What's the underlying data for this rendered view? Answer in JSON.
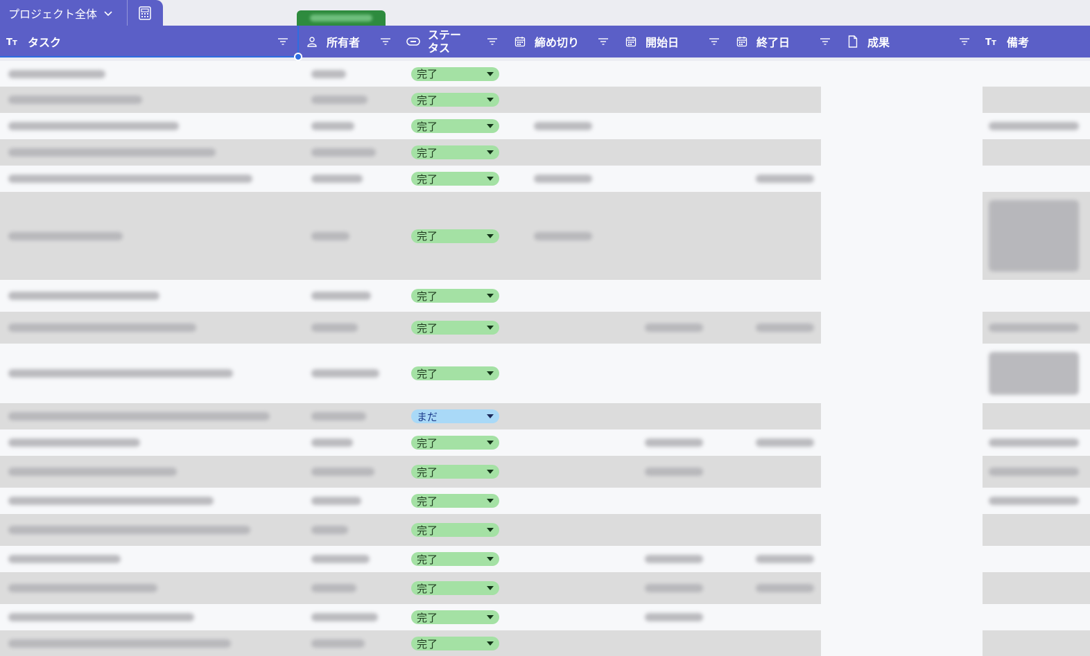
{
  "view": {
    "name": "プロジェクト全体",
    "icons": {
      "dropdown": "chevron-down-icon",
      "calculator": "calculator-icon"
    }
  },
  "columns": [
    {
      "key": "task",
      "label": "タスク",
      "icon": "text-type-icon"
    },
    {
      "key": "owner",
      "label": "所有者",
      "icon": "person-icon"
    },
    {
      "key": "status",
      "label": "ステータス",
      "icon": "status-icon"
    },
    {
      "key": "deadline",
      "label": "締め切り",
      "icon": "calendar-icon"
    },
    {
      "key": "start",
      "label": "開始日",
      "icon": "calendar-icon"
    },
    {
      "key": "end",
      "label": "終了日",
      "icon": "calendar-icon"
    },
    {
      "key": "result",
      "label": "成果",
      "icon": "file-icon"
    },
    {
      "key": "notes",
      "label": "備考",
      "icon": "text-type-icon"
    }
  ],
  "statuses": {
    "done": "完了",
    "todo": "まだ"
  },
  "rows": [
    {
      "status": "done"
    },
    {
      "status": "done"
    },
    {
      "status": "done"
    },
    {
      "status": "done"
    },
    {
      "status": "done"
    },
    {
      "status": "done"
    },
    {
      "status": "done"
    },
    {
      "status": "done"
    },
    {
      "status": "done"
    },
    {
      "status": "todo"
    },
    {
      "status": "done"
    },
    {
      "status": "done"
    },
    {
      "status": "done"
    },
    {
      "status": "done"
    },
    {
      "status": "done"
    },
    {
      "status": "done"
    },
    {
      "status": "done"
    },
    {
      "status": "done"
    }
  ],
  "colors": {
    "header_bg": "#5b5fc7",
    "done_bg": "#a4e1a4",
    "todo_bg": "#a9d9f7",
    "selection": "#2e6de0"
  }
}
